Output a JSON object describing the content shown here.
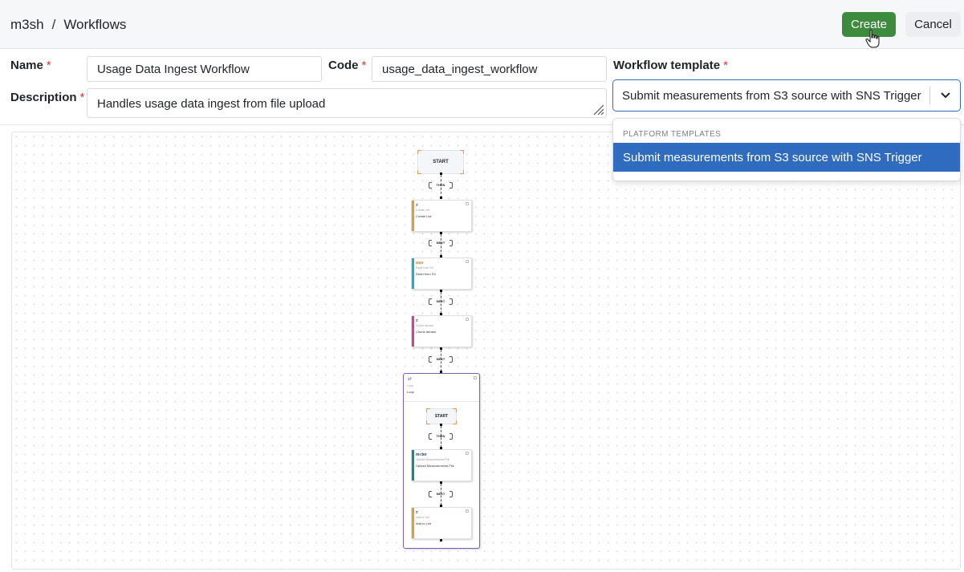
{
  "breadcrumb": {
    "root": "m3sh",
    "separator": "/",
    "current": "Workflows"
  },
  "actions": {
    "create": "Create",
    "cancel": "Cancel"
  },
  "form": {
    "name_label": "Name",
    "name_value": "Usage Data Ingest Workflow",
    "code_label": "Code",
    "code_value": "usage_data_ingest_workflow",
    "description_label": "Description",
    "description_value": "Handles usage data ingest from file upload",
    "template_label": "Workflow template",
    "template_value": "Submit measurements from S3 source with SNS Trigger",
    "required_marker": "*"
  },
  "dropdown": {
    "group": "PLATFORM TEMPLATES",
    "options": [
      "Submit measurements from S3 source with SNS Trigger"
    ]
  },
  "colors": {
    "primary": "#3d8b3d",
    "selected": "#2f6bbf",
    "loop": "#7d5ac7"
  },
  "workflow": {
    "start": "START",
    "then": "THEN",
    "next": "NEXT",
    "steps": [
      {
        "icon": "≠",
        "subtitle": "Create List",
        "title": "Create List",
        "color": "#e0a030"
      },
      {
        "icon": "aws",
        "subtitle": "Read from S3",
        "title": "Read from S3",
        "color": "#1bb0c8"
      },
      {
        "icon": "≠",
        "subtitle": "Chunk Iterator",
        "title": "Chunk Iterator",
        "color": "#d4448a"
      }
    ],
    "loop": {
      "icon": "⇄",
      "subtitle": "Loop",
      "title": "Loop",
      "inner_steps": [
        {
          "icon": "m≡ter",
          "subtitle": "Upload Measurements File",
          "title": "Upload Measurements File",
          "color": "#1a8a7a"
        },
        {
          "icon": "≠",
          "subtitle": "Add to List",
          "title": "Add to List",
          "color": "#e0a030"
        }
      ]
    }
  }
}
